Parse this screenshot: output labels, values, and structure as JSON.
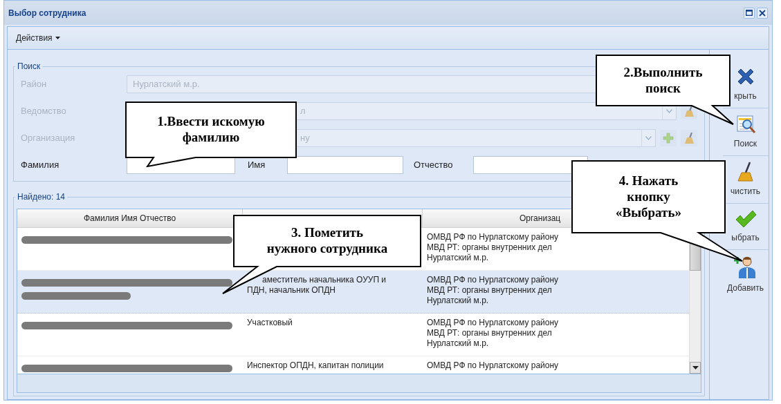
{
  "window": {
    "title": "Выбор сотрудника",
    "controls": [
      {
        "kind": "maximize"
      },
      {
        "kind": "close"
      }
    ]
  },
  "toolbar": {
    "menu": "Действия"
  },
  "search": {
    "legend": "Поиск",
    "fields": [
      {
        "label": "Район",
        "value": "Нурлатский м.р.",
        "disabled": true,
        "dropdown": false
      },
      {
        "label": "Ведомство",
        "value": "л",
        "disabled": true,
        "dropdown": true,
        "actions": [
          {
            "kind": "clear"
          }
        ]
      },
      {
        "label": "Организация",
        "value": "ну",
        "disabled": true,
        "dropdown": true,
        "actions": [
          {
            "kind": "add"
          },
          {
            "kind": "clear"
          }
        ]
      }
    ],
    "name_fields": [
      {
        "label": "Фамилия"
      },
      {
        "label": "Имя"
      },
      {
        "label": "Отчество"
      }
    ]
  },
  "results": {
    "legend": "Найдено: 14",
    "columns": {
      "column_1": "Фамилия Имя Отчество",
      "column_3": "Организац"
    },
    "rows": [
      {
        "redaction": [
          {
            "kind": "long"
          }
        ],
        "selected": false,
        "organization": "ОМВД РФ по Нурлатскому району\nМВД РТ: органы внутренних дел\nНурлатский м.р."
      },
      {
        "redaction": [
          {
            "kind": "long"
          },
          {
            "kind": "short"
          }
        ],
        "selected": true,
        "position": "аместитель начальника ОУУП и\nПДН, начальник ОПДН",
        "organization": "ОМВД РФ по Нурлатскому району\nМВД РТ: органы внутренних дел\nНурлатский м.р."
      },
      {
        "redaction": [
          {
            "kind": "long"
          }
        ],
        "selected": false,
        "position": "Участковый",
        "organization": "ОМВД РФ по Нурлатскому району\nМВД РТ: органы внутренних дел\nНурлатский м.р."
      },
      {
        "redaction": [
          {
            "kind": "long"
          }
        ],
        "selected": false,
        "position": "Инспектор ОПДН, капитан полиции",
        "organization": "ОМВД РФ по Нурлатскому району"
      }
    ]
  },
  "side_buttons": [
    {
      "kind": "close",
      "label": "крыть"
    },
    {
      "kind": "search",
      "label": "Поиск"
    },
    {
      "kind": "clear",
      "label": "чистить"
    },
    {
      "kind": "select",
      "label": "ыбрать"
    },
    {
      "kind": "add",
      "label": "Добавить"
    }
  ],
  "callouts": [
    {
      "text": "1.Ввести искомую\nфамилию"
    },
    {
      "text": "2.Выполнить\nпоиск"
    },
    {
      "text": "3. Пометить\nнужного сотрудника"
    },
    {
      "text": "4. Нажать\nкнопку\n«Выбрать»"
    }
  ]
}
